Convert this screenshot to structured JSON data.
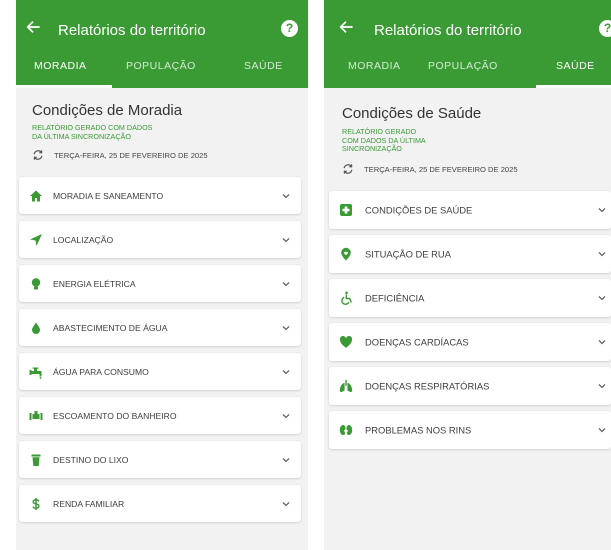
{
  "colors": {
    "primary": "#3a9b35",
    "background": "#f2f2f2",
    "card": "#ffffff"
  },
  "left": {
    "appbar": {
      "title": "Relatórios do território",
      "back_icon": "arrow-left-icon",
      "help_icon": "help-icon"
    },
    "tabs": [
      {
        "label": "MORADIA",
        "active": true
      },
      {
        "label": "POPULAÇÃO",
        "active": false
      },
      {
        "label": "SAÚDE",
        "active": false
      }
    ],
    "section_title": "Condições de Moradia",
    "report_note_lines": [
      "RELATÓRIO GERADO COM DADOS",
      "DA ÚLTIMA SINCRONIZAÇÃO"
    ],
    "sync_date": "TERÇA-FEIRA, 25 DE FEVEREIRO DE 2025",
    "items": [
      {
        "label": "MORADIA E SANEAMENTO",
        "icon": "home-icon"
      },
      {
        "label": "LOCALIZAÇÃO",
        "icon": "location-arrow-icon"
      },
      {
        "label": "ENERGIA ELÉTRICA",
        "icon": "lightbulb-icon"
      },
      {
        "label": "ABASTECIMENTO DE ÁGUA",
        "icon": "water-drop-icon"
      },
      {
        "label": "ÁGUA PARA CONSUMO",
        "icon": "faucet-icon"
      },
      {
        "label": "ESCOAMENTO DO BANHEIRO",
        "icon": "pipe-icon"
      },
      {
        "label": "DESTINO DO LIXO",
        "icon": "trash-icon"
      },
      {
        "label": "RENDA FAMILIAR",
        "icon": "dollar-icon"
      }
    ]
  },
  "right": {
    "appbar": {
      "title": "Relatórios do território",
      "back_icon": "arrow-left-icon",
      "help_icon": "help-icon"
    },
    "tabs": [
      {
        "label": "MORADIA",
        "active": false
      },
      {
        "label": "POPULAÇÃO",
        "active": false
      },
      {
        "label": "SAÚDE",
        "active": true
      }
    ],
    "section_title": "Condições de Saúde",
    "report_note_lines": [
      "RELATÓRIO GERADO",
      "COM DADOS DA ÚLTIMA",
      "SINCRONIZAÇÃO"
    ],
    "sync_date": "TERÇA-FEIRA, 25 DE FEVEREIRO DE 2025",
    "items": [
      {
        "label": "CONDIÇÕES DE SAÚDE",
        "icon": "medical-cross-icon"
      },
      {
        "label": "SITUAÇÃO DE RUA",
        "icon": "map-pin-icon"
      },
      {
        "label": "DEFICIÊNCIA",
        "icon": "wheelchair-icon"
      },
      {
        "label": "DOENÇAS CARDÍACAS",
        "icon": "heart-icon"
      },
      {
        "label": "DOENÇAS RESPIRATÓRIAS",
        "icon": "lungs-icon"
      },
      {
        "label": "PROBLEMAS NOS RINS",
        "icon": "kidneys-icon"
      }
    ]
  }
}
